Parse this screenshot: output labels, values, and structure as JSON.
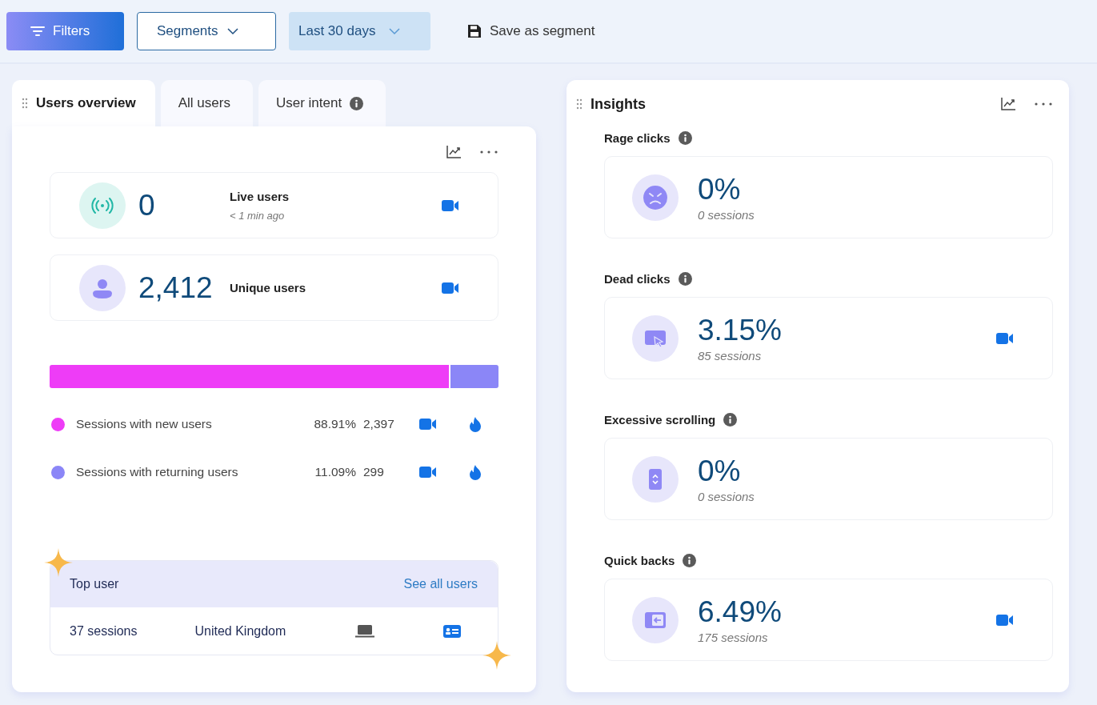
{
  "toolbar": {
    "filters": "Filters",
    "segments": "Segments",
    "date_range": "Last 30 days",
    "save": "Save as segment"
  },
  "tabs": [
    {
      "label": "Users overview",
      "selected": true,
      "info": false
    },
    {
      "label": "All users",
      "selected": false,
      "info": false
    },
    {
      "label": "User intent",
      "selected": false,
      "info": true
    }
  ],
  "stats": [
    {
      "kind": "live",
      "value": "0",
      "label": "Live users",
      "subtitle": "< 1 min ago"
    },
    {
      "kind": "user",
      "value": "2,412",
      "label": "Unique users"
    }
  ],
  "breakdown": [
    {
      "label": "Sessions with new users",
      "color": "#ee3cf7",
      "level": 0.8891,
      "share": "88.91%",
      "count": "2,397"
    },
    {
      "label": "Sessions with returning users",
      "color": "#8b86f7",
      "level": 0.1109,
      "share": "11.09%",
      "count": "299"
    }
  ],
  "top_user": {
    "title": "Top user",
    "link": "See all users",
    "sessions": "37 sessions",
    "country": "United Kingdom"
  },
  "insights": {
    "title": "Insights",
    "items": [
      {
        "kind": "rage",
        "label": "Rage clicks",
        "value": "0%",
        "sessions": "0 sessions",
        "recording": false
      },
      {
        "kind": "dead",
        "label": "Dead clicks",
        "value": "3.15%",
        "sessions": "85 sessions",
        "recording": true
      },
      {
        "kind": "scroll",
        "label": "Excessive scrolling",
        "value": "0%",
        "sessions": "0 sessions",
        "recording": false
      },
      {
        "kind": "back",
        "label": "Quick backs",
        "value": "6.49%",
        "sessions": "175 sessions",
        "recording": true
      }
    ]
  }
}
